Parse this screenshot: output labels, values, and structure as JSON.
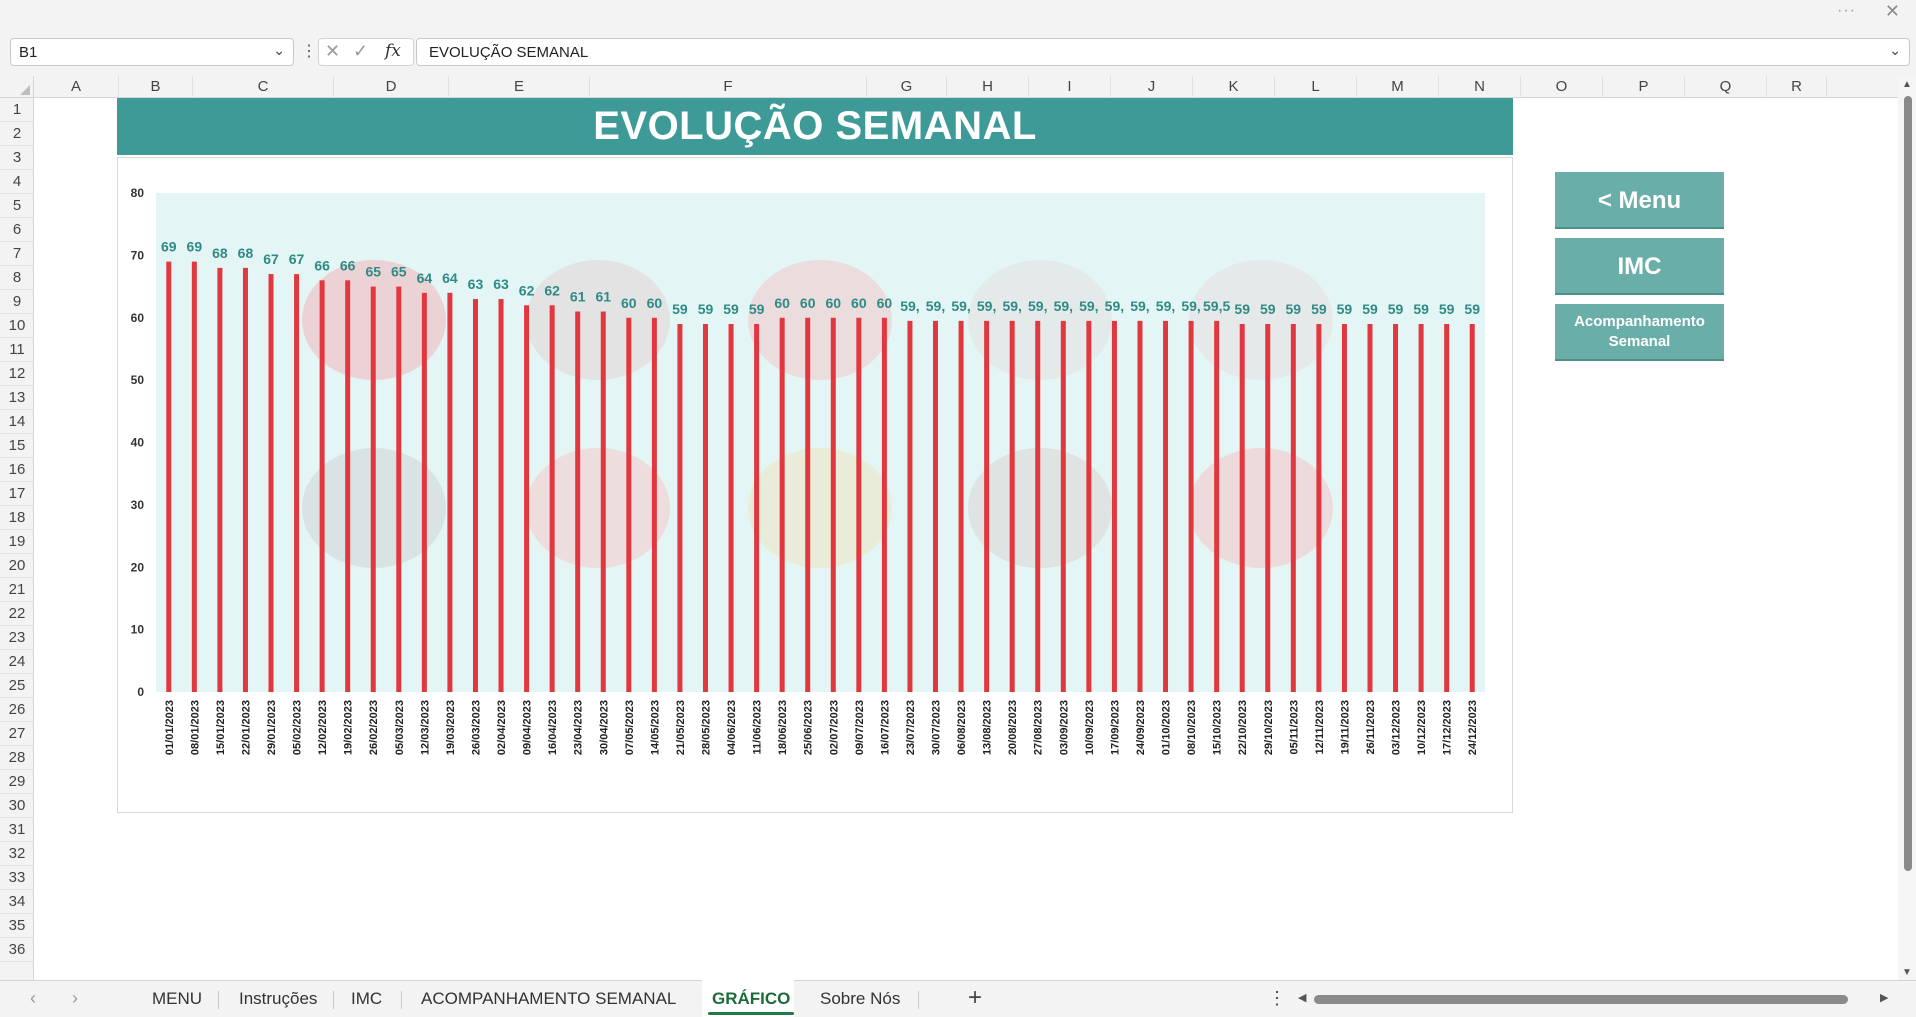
{
  "window": {
    "more_label": "···",
    "close_label": "✕"
  },
  "formula_bar": {
    "name_box": "B1",
    "formula": "EVOLUÇÃO SEMANAL",
    "fx_label": "fx"
  },
  "columns": [
    "A",
    "B",
    "C",
    "D",
    "E",
    "F",
    "G",
    "H",
    "I",
    "J",
    "K",
    "L",
    "M",
    "N",
    "O",
    "P",
    "Q",
    "R"
  ],
  "rows": [
    "1",
    "2",
    "3",
    "4",
    "5",
    "6",
    "7",
    "8",
    "9",
    "10",
    "11",
    "12",
    "13",
    "14",
    "15",
    "16",
    "17",
    "18",
    "19",
    "20",
    "21",
    "22",
    "23",
    "24",
    "25",
    "26",
    "27",
    "28",
    "29",
    "30",
    "31",
    "32",
    "33",
    "34",
    "35",
    "36"
  ],
  "sheet": {
    "banner_title": "EVOLUÇÃO SEMANAL",
    "buttons": {
      "menu": "< Menu",
      "imc": "IMC",
      "acomp_line1": "Acompanhamento",
      "acomp_line2": "Semanal"
    }
  },
  "tabs": {
    "items": [
      "MENU",
      "Instruções",
      "IMC",
      "ACOMPANHAMENTO SEMANAL",
      "GRÁFICO",
      "Sobre Nós"
    ],
    "active": "GRÁFICO",
    "add_label": "+"
  },
  "colors": {
    "banner": "#3d9a96",
    "bar": "#e0383e",
    "label": "#2f8a86",
    "band": "#e3f6f5",
    "button": "#6aaeaa"
  },
  "chart_data": {
    "type": "bar",
    "title": "",
    "xlabel": "",
    "ylabel": "",
    "ylim": [
      0,
      80
    ],
    "yticks": [
      0,
      10,
      20,
      30,
      40,
      50,
      60,
      70,
      80
    ],
    "categories": [
      "01/01/2023",
      "08/01/2023",
      "15/01/2023",
      "22/01/2023",
      "29/01/2023",
      "05/02/2023",
      "12/02/2023",
      "19/02/2023",
      "26/02/2023",
      "05/03/2023",
      "12/03/2023",
      "19/03/2023",
      "26/03/2023",
      "02/04/2023",
      "09/04/2023",
      "16/04/2023",
      "23/04/2023",
      "30/04/2023",
      "07/05/2023",
      "14/05/2023",
      "21/05/2023",
      "28/05/2023",
      "04/06/2023",
      "11/06/2023",
      "18/06/2023",
      "25/06/2023",
      "02/07/2023",
      "09/07/2023",
      "16/07/2023",
      "23/07/2023",
      "30/07/2023",
      "06/08/2023",
      "13/08/2023",
      "20/08/2023",
      "27/08/2023",
      "03/09/2023",
      "10/09/2023",
      "17/09/2023",
      "24/09/2023",
      "01/10/2023",
      "08/10/2023",
      "15/10/2023",
      "22/10/2023",
      "29/10/2023",
      "05/11/2023",
      "12/11/2023",
      "19/11/2023",
      "26/11/2023",
      "03/12/2023",
      "10/12/2023",
      "17/12/2023",
      "24/12/2023"
    ],
    "values": [
      69,
      69,
      68,
      68,
      67,
      67,
      66,
      66,
      65,
      65,
      64,
      64,
      63,
      63,
      62,
      62,
      61,
      61,
      60,
      60,
      59,
      59,
      59,
      59,
      60,
      60,
      60,
      60,
      60,
      59.5,
      59.5,
      59.5,
      59.5,
      59.5,
      59.5,
      59.5,
      59.5,
      59.5,
      59.5,
      59.5,
      59.5,
      59.5,
      59,
      59,
      59,
      59,
      59,
      59,
      59,
      59,
      59,
      59
    ],
    "data_labels": [
      "69",
      "69",
      "68",
      "68",
      "67",
      "67",
      "66",
      "66",
      "65",
      "65",
      "64",
      "64",
      "63",
      "63",
      "62",
      "62",
      "61",
      "61",
      "60",
      "60",
      "59",
      "59",
      "59",
      "59",
      "60",
      "60",
      "60",
      "60",
      "60",
      "59,",
      "59,",
      "59,",
      "59,",
      "59,",
      "59,",
      "59,",
      "59,",
      "59,",
      "59,",
      "59,",
      "59,",
      "59,5",
      "59",
      "59",
      "59",
      "59",
      "59",
      "59",
      "59",
      "59",
      "59",
      "59"
    ],
    "grid": false,
    "legend": "none"
  }
}
